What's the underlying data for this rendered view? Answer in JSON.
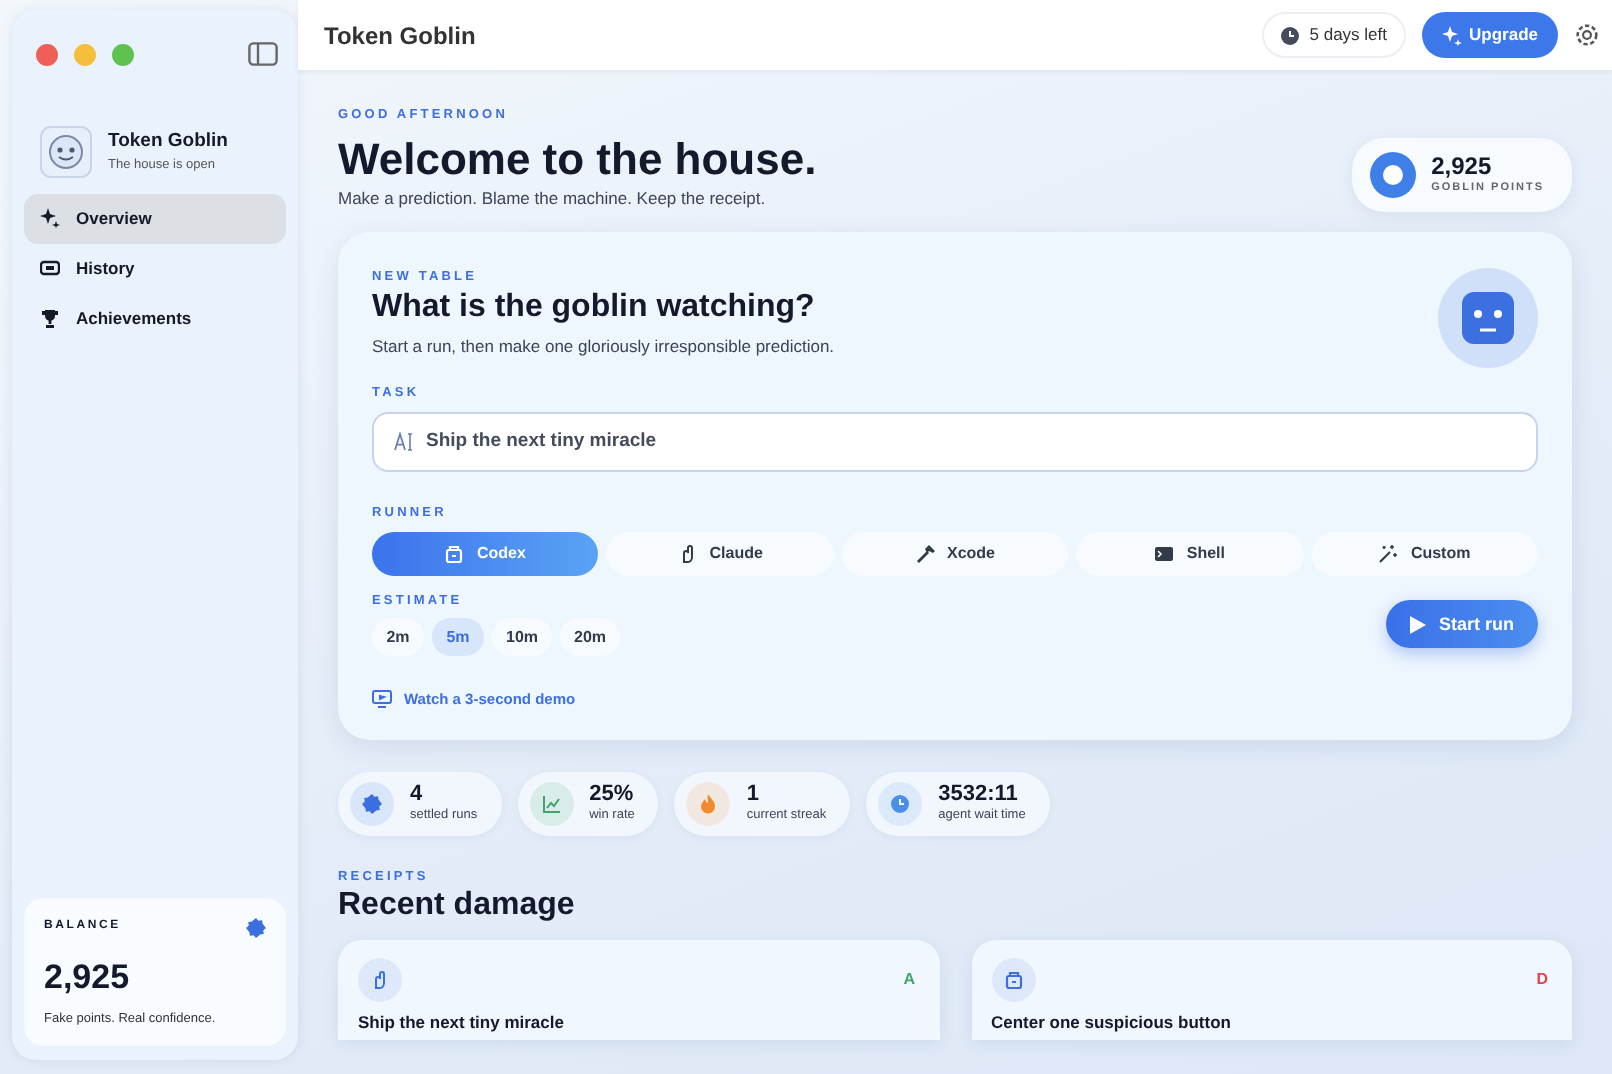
{
  "window": {
    "title": "Token Goblin"
  },
  "toolbar": {
    "trial": "5 days left",
    "upgrade": "Upgrade"
  },
  "sidebar": {
    "app_name": "Token Goblin",
    "app_status": "The house is open",
    "items": [
      {
        "label": "Overview",
        "kind": "sparkle",
        "selected": true
      },
      {
        "label": "History",
        "kind": "ticket",
        "selected": false
      },
      {
        "label": "Achievements",
        "kind": "trophy",
        "selected": false
      }
    ],
    "balance": {
      "label": "BALANCE",
      "value": "2,925",
      "caption": "Fake points. Real confidence."
    }
  },
  "header": {
    "greeting": "GOOD AFTERNOON",
    "title": "Welcome to the house.",
    "subtitle": "Make a prediction. Blame the machine. Keep the receipt.",
    "points": {
      "value": "2,925",
      "label": "GOBLIN POINTS"
    }
  },
  "new_table": {
    "eyebrow": "NEW TABLE",
    "title": "What is the goblin watching?",
    "subtitle": "Start a run, then make one gloriously irresponsible prediction.",
    "task_label": "TASK",
    "task_value": "Ship the next tiny miracle",
    "runner_label": "RUNNER",
    "runners": [
      {
        "label": "Codex",
        "kind": "box",
        "selected": true
      },
      {
        "label": "Claude",
        "kind": "hand",
        "selected": false
      },
      {
        "label": "Xcode",
        "kind": "hammer",
        "selected": false
      },
      {
        "label": "Shell",
        "kind": "terminal",
        "selected": false
      },
      {
        "label": "Custom",
        "kind": "wand",
        "selected": false
      }
    ],
    "estimate_label": "ESTIMATE",
    "estimates": [
      {
        "label": "2m",
        "selected": false
      },
      {
        "label": "5m",
        "selected": true
      },
      {
        "label": "10m",
        "selected": false
      },
      {
        "label": "20m",
        "selected": false
      }
    ],
    "start": "Start run",
    "demo": "Watch a 3-second demo"
  },
  "stats": [
    {
      "value": "4",
      "label": "settled runs",
      "kind": "badge",
      "color": "#3b6fe0"
    },
    {
      "value": "25%",
      "label": "win rate",
      "kind": "chart",
      "color": "#3fa56b"
    },
    {
      "value": "1",
      "label": "current streak",
      "kind": "flame",
      "color": "#f08a2c"
    },
    {
      "value": "3532:11",
      "label": "agent wait time",
      "kind": "clock",
      "color": "#4a90e8"
    }
  ],
  "receipts": {
    "eyebrow": "RECEIPTS",
    "title": "Recent damage",
    "items": [
      {
        "title": "Ship the next tiny miracle",
        "kind": "hand",
        "grade": "A",
        "color": "#3fa56b"
      },
      {
        "title": "Center one suspicious button",
        "kind": "box",
        "grade": "D",
        "color": "#e0434f"
      }
    ]
  }
}
